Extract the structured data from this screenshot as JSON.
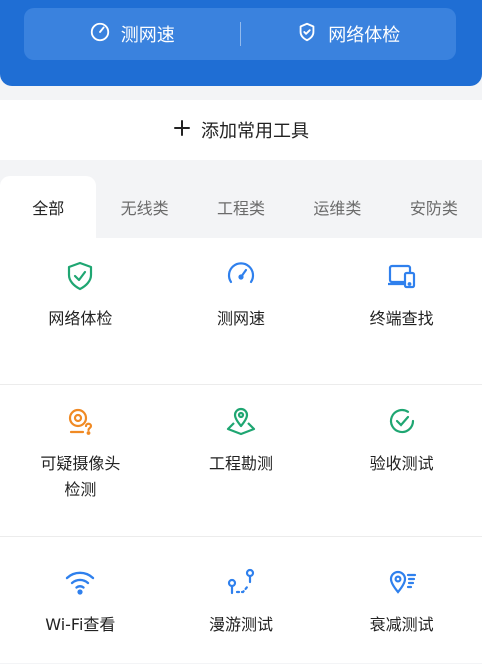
{
  "header": {
    "quick_actions": [
      {
        "label": "测网速",
        "icon": "speed-gauge-icon"
      },
      {
        "label": "网络体检",
        "icon": "shield-check-icon"
      }
    ]
  },
  "add_tools": {
    "label": "添加常用工具",
    "icon": "plus-icon"
  },
  "tabs": [
    {
      "label": "全部",
      "active": true
    },
    {
      "label": "无线类",
      "active": false
    },
    {
      "label": "工程类",
      "active": false
    },
    {
      "label": "运维类",
      "active": false
    },
    {
      "label": "安防类",
      "active": false
    }
  ],
  "tools": [
    {
      "label": "网络体检",
      "icon": "shield-check-icon",
      "color": "#1fa672"
    },
    {
      "label": "测网速",
      "icon": "speed-gauge-icon",
      "color": "#2f80ed"
    },
    {
      "label": "终端查找",
      "icon": "device-search-icon",
      "color": "#2f80ed"
    },
    {
      "label": "可疑摄像头\n检测",
      "icon": "camera-question-icon",
      "color": "#f08a24"
    },
    {
      "label": "工程勘测",
      "icon": "map-pin-icon",
      "color": "#1fa672"
    },
    {
      "label": "验收测试",
      "icon": "check-circle-icon",
      "color": "#1fa672"
    },
    {
      "label": "Wi-Fi查看",
      "icon": "wifi-icon",
      "color": "#2f80ed"
    },
    {
      "label": "漫游测试",
      "icon": "roaming-path-icon",
      "color": "#2f80ed"
    },
    {
      "label": "衰减测试",
      "icon": "signal-attenuation-icon",
      "color": "#2f80ed"
    }
  ],
  "colors": {
    "header_bg": "#1f6ed4",
    "accent": "#2f80ed"
  }
}
